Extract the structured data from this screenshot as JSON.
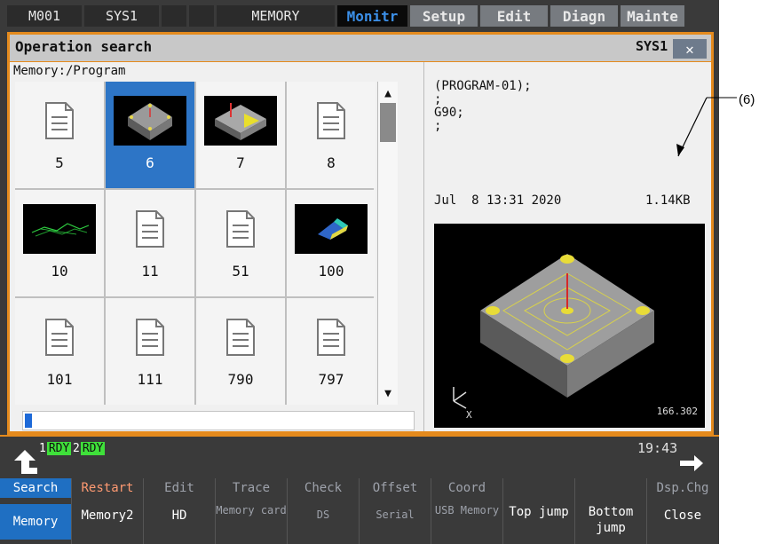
{
  "topbar": {
    "cells": [
      "M001",
      "SYS1",
      "",
      "",
      "MEMORY"
    ],
    "tabs": [
      "Monitr",
      "Setup",
      "Edit",
      "Diagn",
      "Mainte"
    ],
    "active_tab": "Monitr"
  },
  "window": {
    "title": "Operation search",
    "system": "SYS1",
    "close_label": "✕",
    "path": "Memory:/Program",
    "files": [
      {
        "label": "5",
        "kind": "document"
      },
      {
        "label": "6",
        "kind": "3d-thumbnail",
        "selected": true
      },
      {
        "label": "7",
        "kind": "3d-thumbnail"
      },
      {
        "label": "8",
        "kind": "document"
      },
      {
        "label": "10",
        "kind": "3d-thumbnail"
      },
      {
        "label": "11",
        "kind": "document"
      },
      {
        "label": "51",
        "kind": "document"
      },
      {
        "label": "100",
        "kind": "3d-thumbnail"
      },
      {
        "label": "101",
        "kind": "document"
      },
      {
        "label": "111",
        "kind": "document"
      },
      {
        "label": "790",
        "kind": "document"
      },
      {
        "label": "797",
        "kind": "document"
      }
    ],
    "preview_lines": [
      "(PROGRAM-01);",
      ";",
      "G90;",
      ";"
    ],
    "preview_date": "Jul  8 13:31 2020",
    "preview_size": "1.14KB",
    "image_value": "166.302",
    "image_axis": "X"
  },
  "annotation": "(6)",
  "status": {
    "rdy": [
      {
        "num": "1",
        "text": "RDY"
      },
      {
        "num": "2",
        "text": "RDY"
      }
    ],
    "clock": "19:43"
  },
  "menu": [
    {
      "top": "Search",
      "bottom": "Memory",
      "top_hl": true,
      "bottom_hl": true
    },
    {
      "top": "Restart",
      "bottom": "Memory2",
      "top_on": true
    },
    {
      "top": "Edit",
      "bottom": "HD"
    },
    {
      "top": "Trace",
      "bottom": "Memory card",
      "bottom_dim": true
    },
    {
      "top": "Check",
      "bottom": "DS",
      "bottom_dim": true
    },
    {
      "top": "Offset",
      "bottom": "Serial",
      "bottom_dim": true
    },
    {
      "top": "Coord",
      "bottom": "USB Memory",
      "bottom_dim": true
    },
    {
      "top": "",
      "bottom": "Top jump",
      "two": true
    },
    {
      "top": "",
      "bottom": "Bottom jump",
      "two": true
    },
    {
      "top": "Dsp.Chg",
      "bottom": "Close"
    }
  ],
  "colors": {
    "accent": "#e48a1d",
    "selected": "#2d75c6",
    "active_tab_text": "#3b8fe8",
    "rdy": "#3fe03a"
  }
}
